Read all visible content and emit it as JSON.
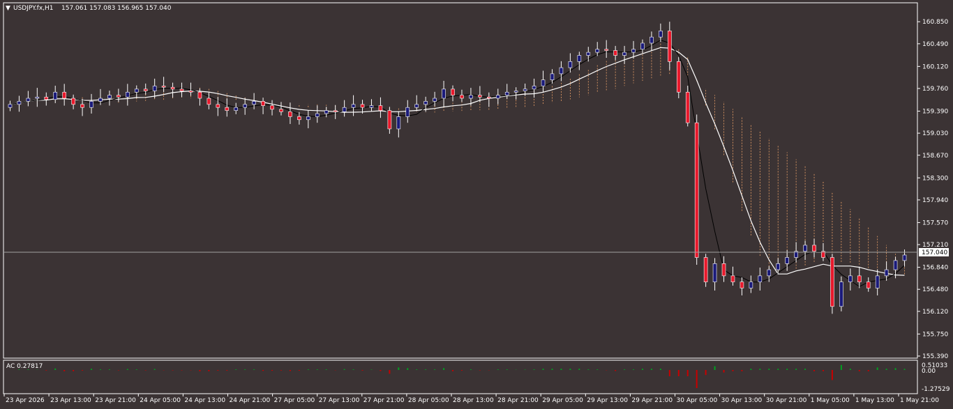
{
  "chart_header": {
    "menu_glyph": "▼",
    "symbol": "USDJPY.fx,H1",
    "ohlc": "157.061 157.083 156.965 157.040"
  },
  "colors": {
    "background": "#3b3334",
    "grid_border": "#ffffff",
    "bull_body": "#1a1a7a",
    "bear_body": "#e8192c",
    "candle_outline": "#ffffff",
    "ma_fast": "#ffffff",
    "ma_slow": "#000000",
    "cloud": "#f0a46a",
    "ac_up": "#00a020",
    "ac_down": "#c80000",
    "price_line": "#a0a0a0",
    "arrow_up": "#1fd21f"
  },
  "price_label": "157.040",
  "indicator": {
    "label": "AC 0.27817",
    "scale": [
      "0.51033",
      "0.00",
      "-1.27529"
    ]
  },
  "chart_data": {
    "type": "candlestick",
    "title": "USDJPY.fx,H1",
    "ylim": [
      155.39,
      161.0
    ],
    "y_ticks": [
      "160.850",
      "160.490",
      "160.120",
      "159.760",
      "159.390",
      "159.030",
      "158.670",
      "158.300",
      "157.940",
      "157.570",
      "157.210",
      "156.840",
      "156.480",
      "156.120",
      "155.750",
      "155.390"
    ],
    "x_ticks": [
      "23 Apr 2026",
      "23 Apr 13:00",
      "23 Apr 21:00",
      "24 Apr 05:00",
      "24 Apr 13:00",
      "24 Apr 21:00",
      "27 Apr 05:00",
      "27 Apr 13:00",
      "27 Apr 21:00",
      "28 Apr 05:00",
      "28 Apr 13:00",
      "28 Apr 21:00",
      "29 Apr 05:00",
      "29 Apr 13:00",
      "29 Apr 21:00",
      "30 Apr 05:00",
      "30 Apr 13:00",
      "30 Apr 21:00",
      "1 May 05:00",
      "1 May 13:00",
      "1 May 21:00"
    ],
    "last_price": 157.04,
    "series_close": [
      159.5,
      159.55,
      159.6,
      159.62,
      159.58,
      159.7,
      159.6,
      159.5,
      159.45,
      159.55,
      159.6,
      159.65,
      159.62,
      159.7,
      159.75,
      159.72,
      159.8,
      159.78,
      159.75,
      159.72,
      159.7,
      159.6,
      159.5,
      159.45,
      159.4,
      159.45,
      159.5,
      159.55,
      159.48,
      159.42,
      159.38,
      159.3,
      159.25,
      159.3,
      159.35,
      159.4,
      159.38,
      159.45,
      159.5,
      159.45,
      159.48,
      159.4,
      159.1,
      159.3,
      159.45,
      159.5,
      159.55,
      159.6,
      159.75,
      159.65,
      159.6,
      159.65,
      159.62,
      159.6,
      159.65,
      159.7,
      159.72,
      159.75,
      159.8,
      159.9,
      160.0,
      160.1,
      160.2,
      160.3,
      160.35,
      160.4,
      160.38,
      160.3,
      160.35,
      160.4,
      160.5,
      160.6,
      160.7,
      160.2,
      159.7,
      159.2,
      157.0,
      156.6,
      156.9,
      156.7,
      156.6,
      156.5,
      156.6,
      156.7,
      156.8,
      156.9,
      157.0,
      157.1,
      157.2,
      157.1,
      157.0,
      156.2,
      156.6,
      156.7,
      156.6,
      156.5,
      156.7,
      156.8,
      156.95,
      157.04
    ],
    "series_open": [
      159.45,
      159.5,
      159.55,
      159.6,
      159.62,
      159.58,
      159.7,
      159.6,
      159.5,
      159.45,
      159.55,
      159.6,
      159.65,
      159.62,
      159.7,
      159.75,
      159.72,
      159.8,
      159.78,
      159.75,
      159.72,
      159.7,
      159.6,
      159.5,
      159.45,
      159.4,
      159.45,
      159.5,
      159.55,
      159.48,
      159.42,
      159.38,
      159.3,
      159.25,
      159.3,
      159.35,
      159.4,
      159.38,
      159.45,
      159.5,
      159.45,
      159.48,
      159.4,
      159.1,
      159.3,
      159.45,
      159.5,
      159.55,
      159.6,
      159.75,
      159.65,
      159.6,
      159.65,
      159.62,
      159.6,
      159.65,
      159.7,
      159.72,
      159.75,
      159.8,
      159.9,
      160.0,
      160.1,
      160.2,
      160.3,
      160.35,
      160.4,
      160.38,
      160.3,
      160.35,
      160.4,
      160.5,
      160.6,
      160.7,
      160.2,
      159.7,
      159.2,
      157.0,
      156.6,
      156.9,
      156.7,
      156.6,
      156.5,
      156.6,
      156.7,
      156.8,
      156.9,
      157.0,
      157.1,
      157.2,
      157.1,
      157.0,
      156.2,
      156.6,
      156.7,
      156.6,
      156.5,
      156.7,
      156.8,
      156.95
    ]
  }
}
